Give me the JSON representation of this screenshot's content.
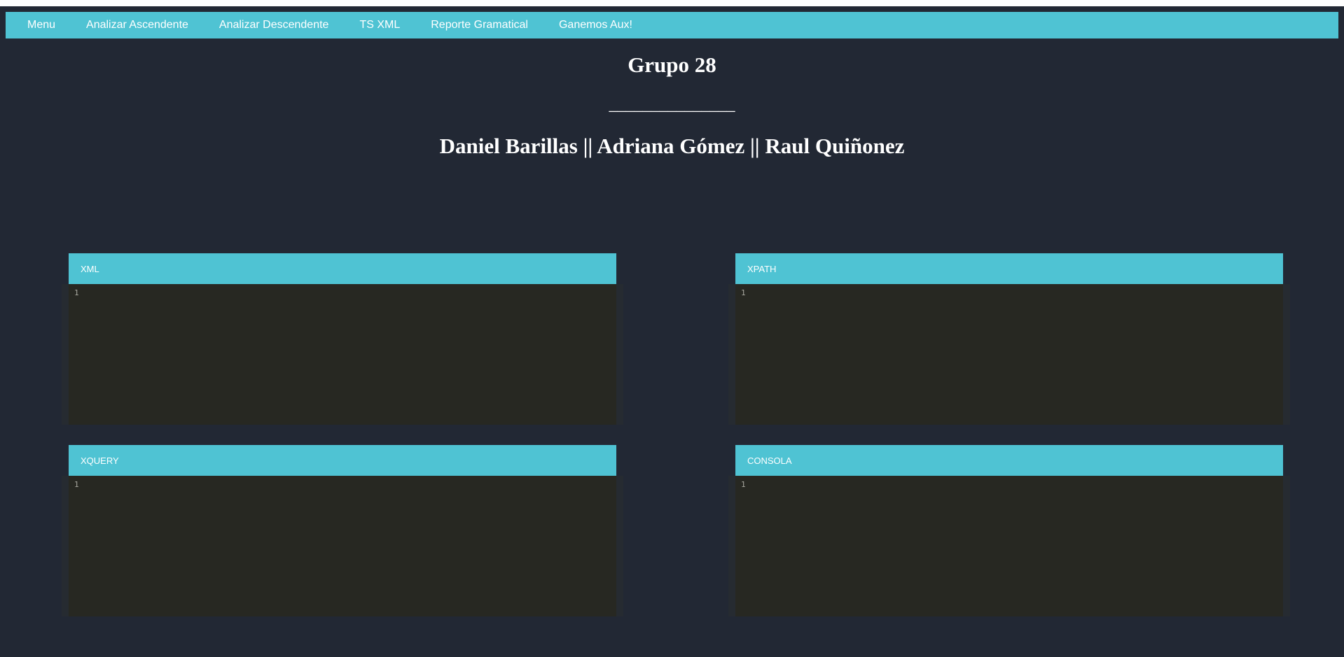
{
  "nav": {
    "items": [
      {
        "label": "Menu"
      },
      {
        "label": "Analizar Ascendente"
      },
      {
        "label": "Analizar Descendente"
      },
      {
        "label": "TS XML"
      },
      {
        "label": "Reporte Gramatical"
      },
      {
        "label": "Ganemos Aux!"
      }
    ]
  },
  "header": {
    "title": "Grupo 28",
    "separator": "_______________",
    "authors": "Daniel Barillas || Adriana Gómez || Raul Quiñonez"
  },
  "panels": {
    "xml": {
      "title": "XML",
      "line": "1"
    },
    "xpath": {
      "title": "XPATH",
      "line": "1"
    },
    "xquery": {
      "title": "XQUERY",
      "line": "1"
    },
    "consola": {
      "title": "CONSOLA",
      "line": "1"
    }
  },
  "colors": {
    "background": "#222834",
    "accent": "#4fc3d3",
    "editor": "#272822"
  }
}
